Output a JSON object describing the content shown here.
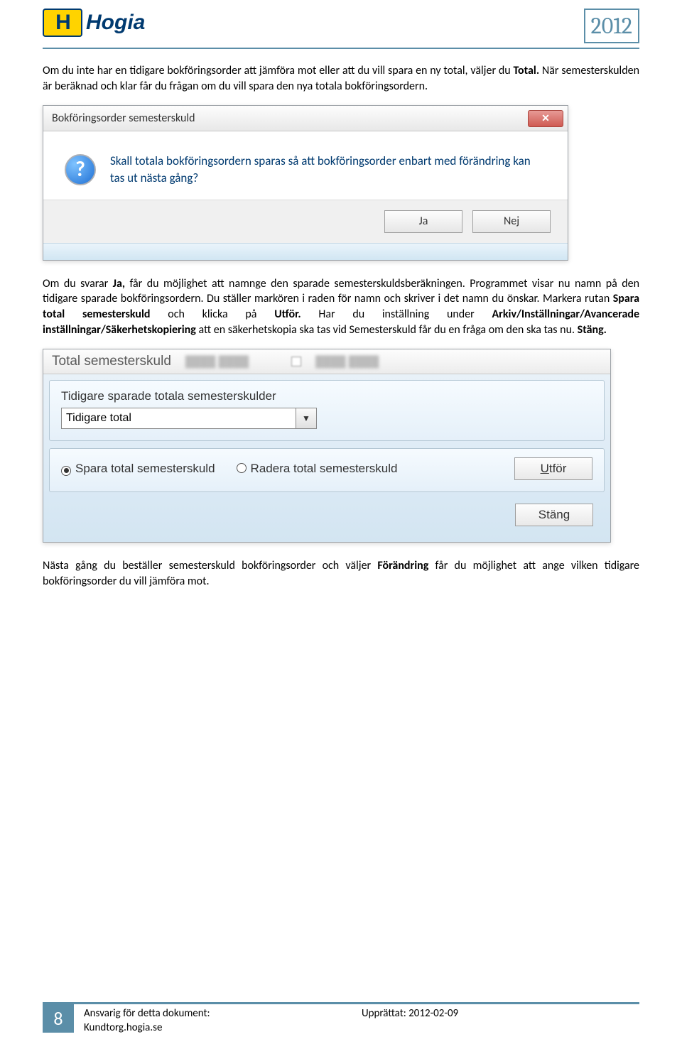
{
  "header": {
    "logo_letter": "H",
    "logo_text": "Hogia",
    "year": "2012"
  },
  "para1_a": "Om du inte har en tidigare bokföringsorder att jämföra mot eller att du vill spara en ny total, väljer du ",
  "para1_b": "Total.",
  "para1_c": " När semesterskulden är beräknad och klar får du frågan om du vill spara den nya totala bokföringsordern.",
  "dialog1": {
    "title": "Bokföringsorder semesterskuld",
    "question": "Skall totala bokföringsordern sparas så att bokföringsorder enbart med förändring kan tas ut nästa gång?",
    "yes": "Ja",
    "no": "Nej"
  },
  "para2_a": "Om du svarar ",
  "para2_b": "Ja,",
  "para2_c": " får du möjlighet att namnge den sparade semesterskuldsberäkningen. Programmet visar nu namn på den tidigare sparade bokföringsordern. Du ställer markören i raden för namn och skriver i det namn du önskar. Markera rutan ",
  "para2_d": "Spara total semesterskuld",
  "para2_e": " och klicka på ",
  "para2_f": "Utför.",
  "para2_g": " Har du inställning under ",
  "para2_h": "Arkiv/Inställningar/Avancerade inställningar/Säkerhetskopiering",
  "para2_i": " att en säkerhetskopia ska tas vid Semesterskuld får du en fråga om den ska tas nu. ",
  "para2_j": "Stäng.",
  "dialog2": {
    "title": "Total semesterskuld",
    "panel_label": "Tidigare sparade totala semesterskulder",
    "combo_value": "Tidigare total",
    "radio_save": "Spara total semesterskuld",
    "radio_delete": "Radera total semesterskuld",
    "execute_u": "U",
    "execute_rest": "tför",
    "close": "Stäng"
  },
  "para3_a": "Nästa gång du beställer semesterskuld bokföringsorder och väljer ",
  "para3_b": "Förändring",
  "para3_c": " får du möjlighet att ange vilken tidigare bokföringsorder du vill jämföra mot.",
  "footer": {
    "page": "8",
    "col1_a": "Ansvarig för detta dokument:",
    "col1_b": "Kundtorg.hogia.se",
    "col2": "Upprättat: 2012-02-09"
  }
}
